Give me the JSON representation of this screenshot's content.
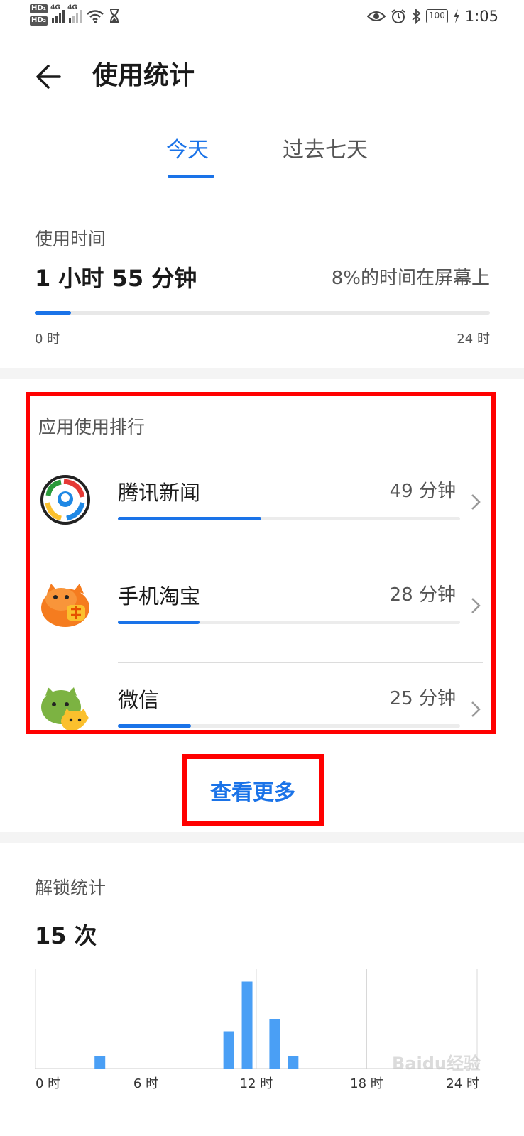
{
  "status_bar": {
    "hd1": "HD₁",
    "hd2": "HD₂",
    "sig1_tag": "4G",
    "sig2_tag": "4G",
    "battery": "100",
    "time": "1:05",
    "icons": [
      "eye-comfort-icon",
      "alarm-icon",
      "bluetooth-icon",
      "battery-icon",
      "charging-icon",
      "wifi-icon",
      "hourglass-icon"
    ]
  },
  "header": {
    "title": "使用统计"
  },
  "tabs": [
    {
      "label": "今天",
      "active": true
    },
    {
      "label": "过去七天",
      "active": false
    }
  ],
  "usage": {
    "label": "使用时间",
    "total": "1 小时 55 分钟",
    "percent_text": "8%的时间在屏幕上",
    "fraction_of_day": 0.08,
    "axis_start": "0 时",
    "axis_end": "24 时"
  },
  "ranking": {
    "title": "应用使用排行",
    "apps": [
      {
        "name": "腾讯新闻",
        "time": "49 分钟",
        "minutes": 49,
        "icon": "tencent-news-icon"
      },
      {
        "name": "手机淘宝",
        "time": "28 分钟",
        "minutes": 28,
        "icon": "taobao-icon"
      },
      {
        "name": "微信",
        "time": "25 分钟",
        "minutes": 25,
        "icon": "wechat-icon"
      }
    ]
  },
  "view_more": "查看更多",
  "unlock": {
    "label": "解锁统计",
    "count": "15 次"
  },
  "accent_color": "#1a73e8",
  "highlight_color": "#ff0000",
  "watermark": "Baidu经验",
  "chart_data": {
    "type": "bar",
    "x_unit": "hour",
    "xlim": [
      0,
      24
    ],
    "ticks": [
      "0 时",
      "6 时",
      "12 时",
      "18 时",
      "24 时"
    ],
    "x": [
      3.5,
      10.5,
      11.5,
      13,
      14
    ],
    "values": [
      1,
      3,
      7,
      4,
      1
    ],
    "color": "#4a9ff5",
    "grid": "vertical"
  }
}
